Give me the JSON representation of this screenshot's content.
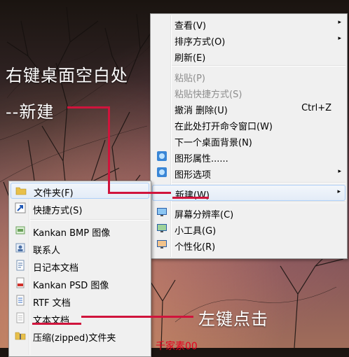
{
  "annotations": {
    "right_click_text": "右键桌面空白处",
    "new_text": "--新建",
    "left_click_text": "左键点击"
  },
  "context_menu": {
    "items": [
      {
        "label": "查看(V)",
        "arrow": "▸"
      },
      {
        "label": "排序方式(O)",
        "arrow": "▸"
      },
      {
        "label": "刷新(E)"
      },
      {
        "label": "粘贴(P)"
      },
      {
        "label": "粘贴快捷方式(S)"
      },
      {
        "label": "撤消 删除(U)",
        "shortcut": "Ctrl+Z"
      },
      {
        "label": "在此处打开命令窗口(W)"
      },
      {
        "label": "下一个桌面背景(N)"
      },
      {
        "label": "图形属性......"
      },
      {
        "label": "图形选项",
        "arrow": "▸"
      },
      {
        "label": "新建(W)",
        "arrow": "▸"
      },
      {
        "label": "屏幕分辨率(C)"
      },
      {
        "label": "小工具(G)"
      },
      {
        "label": "个性化(R)"
      }
    ]
  },
  "new_submenu": {
    "items": [
      {
        "label": "文件夹(F)"
      },
      {
        "label": "快捷方式(S)"
      },
      {
        "label": "Kankan BMP 图像"
      },
      {
        "label": "联系人"
      },
      {
        "label": "日记本文档"
      },
      {
        "label": "Kankan PSD 图像"
      },
      {
        "label": "RTF 文档"
      },
      {
        "label": "文本文档"
      },
      {
        "label": "压缩(zipped)文件夹"
      }
    ]
  },
  "bottom_partial_text": "千家素00",
  "colors": {
    "annotation_line": "#d0143c",
    "menu_bg": "#f0f0f0",
    "highlight_border": "#aecff7"
  }
}
